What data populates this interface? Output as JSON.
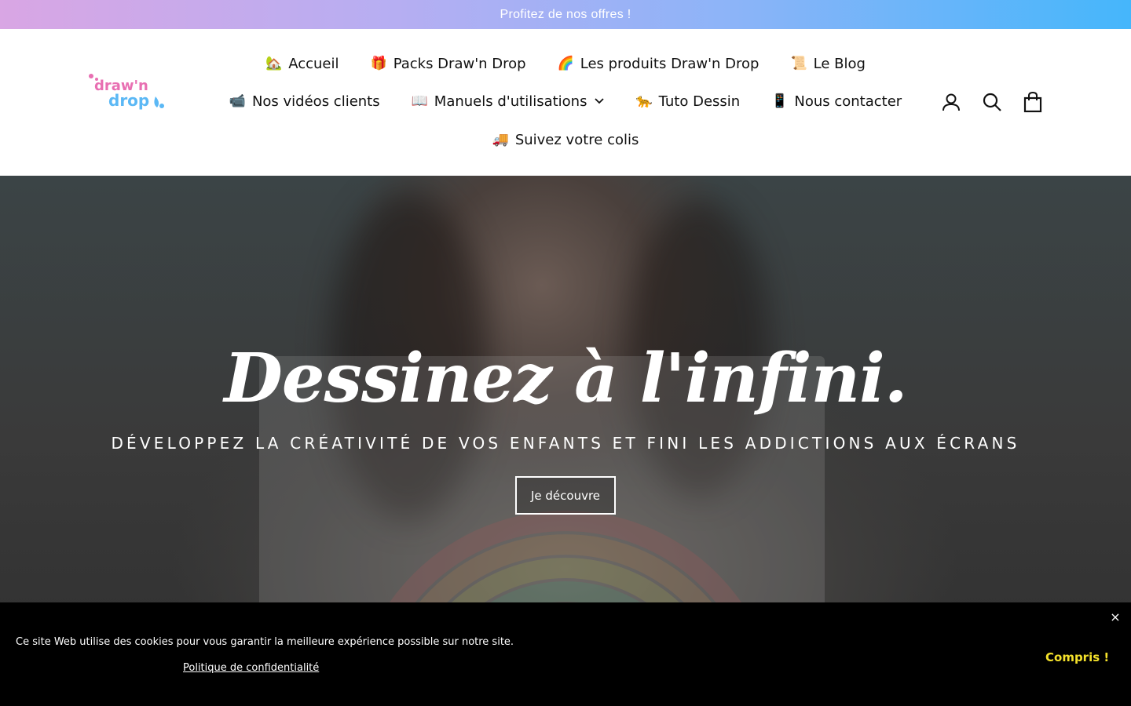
{
  "announcement": {
    "text": "Profitez de nos offres !"
  },
  "brand": {
    "logo_text_1": "draw'n",
    "logo_text_2": "drop",
    "colors": {
      "pink": "#e86fb2",
      "blue": "#5bb8f5",
      "accent_yellow": "#f5e22b"
    }
  },
  "nav": {
    "row1": [
      {
        "emoji": "🏡",
        "label": "Accueil"
      },
      {
        "emoji": "🎁",
        "label": "Packs Draw'n Drop"
      },
      {
        "emoji": "🌈",
        "label": "Les produits Draw'n Drop"
      },
      {
        "emoji": "📜",
        "label": "Le Blog"
      }
    ],
    "row2": [
      {
        "emoji": "📹",
        "label": "Nos vidéos clients"
      },
      {
        "emoji": "📖",
        "label": "Manuels d'utilisations"
      },
      {
        "emoji": "🐆",
        "label": "Tuto Dessin"
      },
      {
        "emoji": "📱",
        "label": "Nous contacter"
      }
    ],
    "row3": [
      {
        "emoji": "🚚",
        "label": "Suivez votre colis"
      }
    ]
  },
  "header_icons": [
    "account-icon",
    "search-icon",
    "cart-icon"
  ],
  "hero": {
    "title": "Dessinez à l'infini.",
    "subtitle": "DÉVELOPPEZ LA CRÉATIVITÉ DE VOS ENFANTS ET FINI LES ADDICTIONS AUX ÉCRANS",
    "button_label": "Je découvre"
  },
  "cookie": {
    "text": "Ce site Web utilise des cookies pour vous garantir la meilleure expérience possible sur notre site.",
    "policy_link": "Politique de confidentialité",
    "accept_label": "Compris !",
    "close_glyph": "×"
  }
}
